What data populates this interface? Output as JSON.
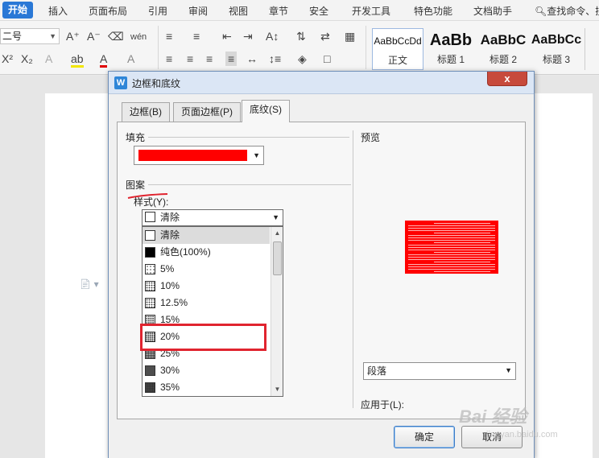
{
  "menubar": {
    "tabs": [
      "开始",
      "插入",
      "页面布局",
      "引用",
      "审阅",
      "视图",
      "章节",
      "安全",
      "开发工具",
      "特色功能",
      "文档助手"
    ],
    "search": "查找命令、搜"
  },
  "toolbar": {
    "font_size": "二号",
    "styles": [
      {
        "sample": "AaBbCcDd",
        "label": "正文"
      },
      {
        "sample": "AaBb",
        "label": "标题 1"
      },
      {
        "sample": "AaBbC",
        "label": "标题 2"
      },
      {
        "sample": "AaBbCc",
        "label": "标题 3"
      }
    ]
  },
  "dialog": {
    "title": "边框和底纹",
    "close_label": "x",
    "tabs": [
      "边框(B)",
      "页面边框(P)",
      "底纹(S)"
    ],
    "active_tab": "底纹(S)",
    "fill_label": "填充",
    "fill_color": "#ff0000",
    "pattern_label": "图案",
    "style_label": "样式(Y):",
    "style_selected": "清除",
    "style_options": [
      "清除",
      "纯色(100%)",
      "5%",
      "10%",
      "12.5%",
      "15%",
      "20%",
      "25%",
      "30%",
      "35%"
    ],
    "preview_label": "预览",
    "apply_label": "应用于(L):",
    "apply_value": "段落",
    "ok_label": "确定",
    "cancel_label": "取消"
  },
  "watermark": {
    "text": "Bai 经验",
    "url": "jingyan.baidu.com"
  }
}
